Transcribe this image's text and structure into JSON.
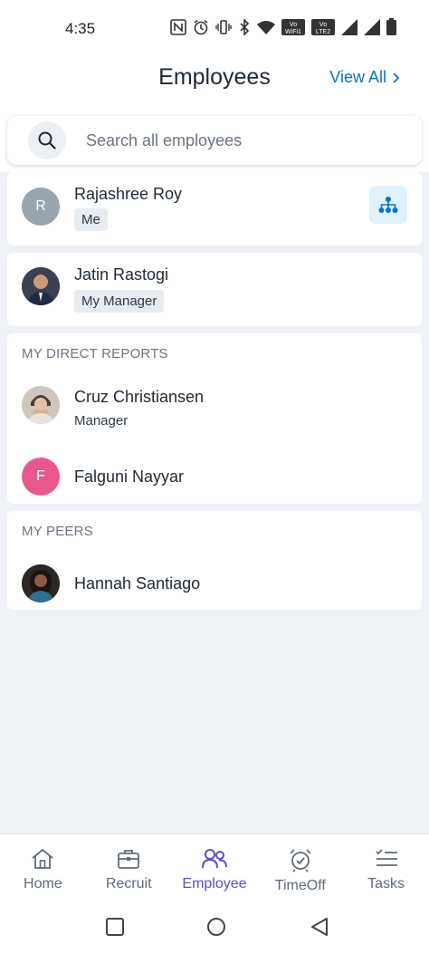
{
  "status_bar": {
    "time": "4:35",
    "icons": [
      "nfc-icon",
      "alarm-icon",
      "vibrate-icon",
      "bluetooth-icon",
      "wifi-icon",
      "vowifi-icon",
      "volte-icon",
      "signal-icon",
      "signal-icon",
      "battery-icon"
    ],
    "vowifi_top": "Vo",
    "vowifi_bottom": "WiFi1",
    "volte_top": "Vo",
    "volte_bottom": "LTE2"
  },
  "header": {
    "title": "Employees",
    "view_all_label": "View All"
  },
  "search": {
    "placeholder": "Search all employees"
  },
  "me": {
    "initial": "R",
    "name": "Rajashree Roy",
    "tag": "Me",
    "avatar_color": "#98a4ae"
  },
  "manager": {
    "name": "Jatin Rastogi",
    "tag": "My Manager"
  },
  "direct_reports": {
    "label": "MY DIRECT REPORTS",
    "items": [
      {
        "name": "Cruz Christiansen",
        "subtitle": "Manager"
      },
      {
        "initial": "F",
        "name": "Falguni Nayyar",
        "avatar_color": "#e8588f"
      }
    ]
  },
  "peers": {
    "label": "MY PEERS",
    "items": [
      {
        "name": "Hannah Santiago"
      }
    ]
  },
  "bottom_nav": {
    "items": [
      {
        "label": "Home",
        "icon": "home-icon"
      },
      {
        "label": "Recruit",
        "icon": "briefcase-icon"
      },
      {
        "label": "Employee",
        "icon": "people-icon",
        "active": true
      },
      {
        "label": "TimeOff",
        "icon": "alarm-clock-icon"
      },
      {
        "label": "Tasks",
        "icon": "task-list-icon"
      }
    ]
  },
  "colors": {
    "accent": "#0b72c4",
    "active_nav": "#5b4fbf",
    "background": "#eef1f5"
  }
}
